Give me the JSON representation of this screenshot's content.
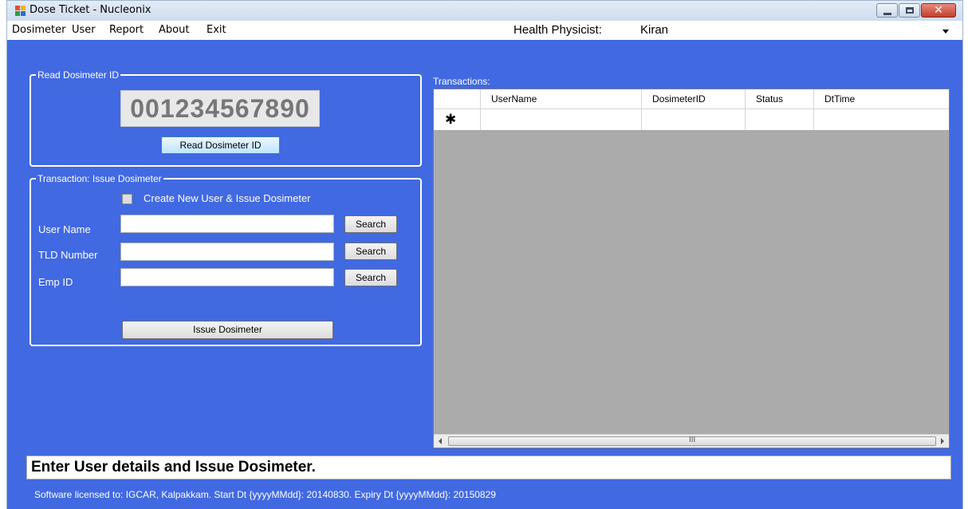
{
  "window": {
    "title": "Dose Ticket - Nucleonix",
    "close_glyph": "✕"
  },
  "menu": {
    "items": [
      "Dosimeter",
      "User",
      "Report",
      "About",
      "Exit"
    ],
    "health_physicist_label": "Health Physicist:",
    "health_physicist_value": "Kiran"
  },
  "read_group": {
    "legend": "Read Dosimeter ID",
    "dosimeter_id": "001234567890",
    "read_button": "Read Dosimeter ID"
  },
  "issue_group": {
    "legend": "Transaction: Issue Dosimeter",
    "create_new_label": "Create New User & Issue Dosimeter",
    "create_new_checked": false,
    "fields": [
      {
        "label": "User Name",
        "value": "",
        "button": "Search"
      },
      {
        "label": "TLD Number",
        "value": "",
        "button": "Search"
      },
      {
        "label": "Emp ID",
        "value": "",
        "button": "Search"
      }
    ],
    "issue_button": "Issue Dosimeter"
  },
  "transactions": {
    "label": "Transactions:",
    "columns": [
      "UserName",
      "DosimeterID",
      "Status",
      "DtTime"
    ],
    "new_row_marker": "✱",
    "scroll_grip": "III"
  },
  "status_message": "Enter User details and Issue Dosimeter.",
  "license_text": "Software licensed to: IGCAR, Kalpakkam. Start Dt {yyyyMMdd}: 20140830. Expiry Dt {yyyyMMdd}: 20150829"
}
